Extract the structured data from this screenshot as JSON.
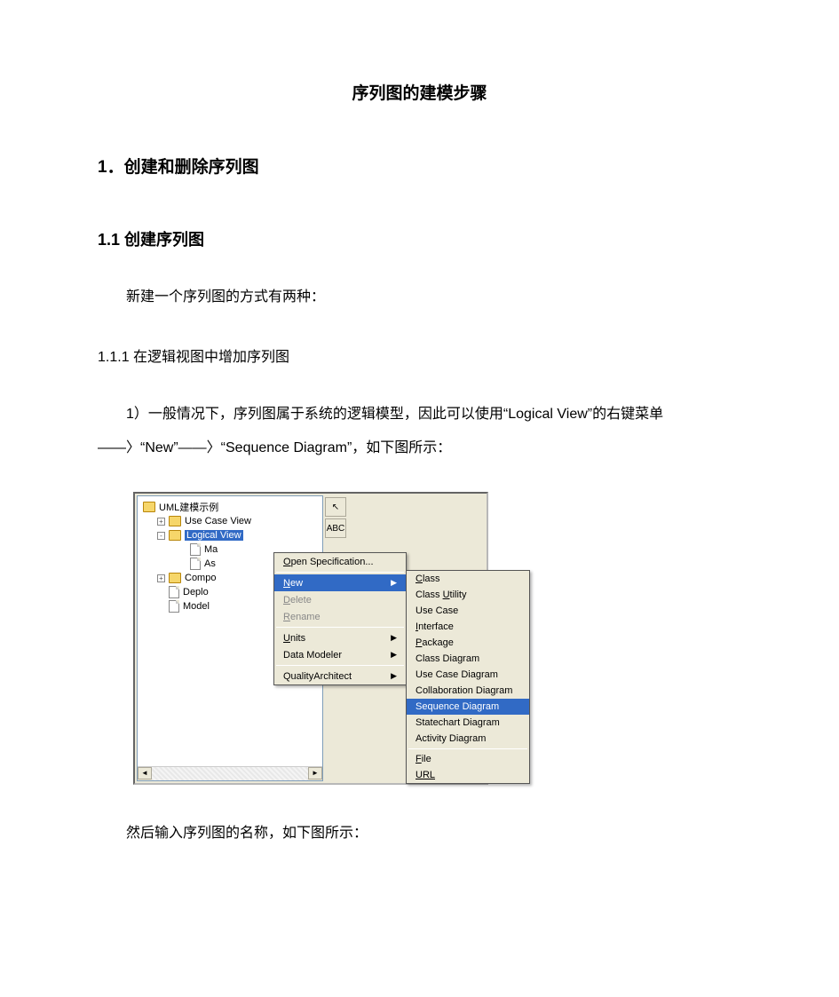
{
  "title": "序列图的建模步骤",
  "sections": {
    "s1": {
      "heading": "1．创建和删除序列图"
    },
    "s1_1": {
      "heading": "1.1 创建序列图",
      "para": "新建一个序列图的方式有两种："
    },
    "s1_1_1": {
      "heading": "1.1.1 在逻辑视图中增加序列图",
      "para": "1）一般情况下，序列图属于系统的逻辑模型，因此可以使用“Logical View”的右键菜单——〉“New”——〉“Sequence Diagram”，如下图所示："
    },
    "after_image": "然后输入序列图的名称，如下图所示："
  },
  "screenshot": {
    "tree": {
      "root": "UML建模示例",
      "items": [
        {
          "label": "Use Case View",
          "type": "folder",
          "expand": "+"
        },
        {
          "label": "Logical View",
          "type": "folder",
          "expand": "-",
          "selected": true
        },
        {
          "label": "Ma",
          "type": "file",
          "level": 3
        },
        {
          "label": "As",
          "type": "file",
          "level": 3
        },
        {
          "label": "Compo",
          "type": "folder",
          "expand": "+"
        },
        {
          "label": "Deplo",
          "type": "file"
        },
        {
          "label": "Model",
          "type": "file"
        }
      ]
    },
    "toolbox": {
      "pointer": "↖",
      "abc": "ABC"
    },
    "ctx1": [
      {
        "label": "Open Specification...",
        "key": "O"
      },
      {
        "sep": true
      },
      {
        "label": "New",
        "key": "N",
        "highlight": true,
        "submenu": true
      },
      {
        "label": "Delete",
        "key": "D",
        "disabled": true
      },
      {
        "label": "Rename",
        "key": "R",
        "disabled": true
      },
      {
        "sep": true
      },
      {
        "label": "Units",
        "key": "U",
        "submenu": true
      },
      {
        "label": "Data Modeler",
        "submenu": true
      },
      {
        "sep": true
      },
      {
        "label": "QualityArchitect",
        "submenu": true
      }
    ],
    "ctx2": [
      {
        "label": "Class",
        "key": "C"
      },
      {
        "label": "Class Utility",
        "key": "U"
      },
      {
        "label": "Use Case"
      },
      {
        "label": "Interface",
        "key": "I"
      },
      {
        "label": "Package",
        "key": "P"
      },
      {
        "label": "Class Diagram"
      },
      {
        "label": "Use Case Diagram"
      },
      {
        "label": "Collaboration Diagram"
      },
      {
        "label": "Sequence Diagram",
        "highlight": true
      },
      {
        "label": "Statechart Diagram"
      },
      {
        "label": "Activity Diagram"
      },
      {
        "sep": true
      },
      {
        "label": "File",
        "key": "F"
      },
      {
        "label": "URL",
        "key": "URL"
      }
    ]
  }
}
